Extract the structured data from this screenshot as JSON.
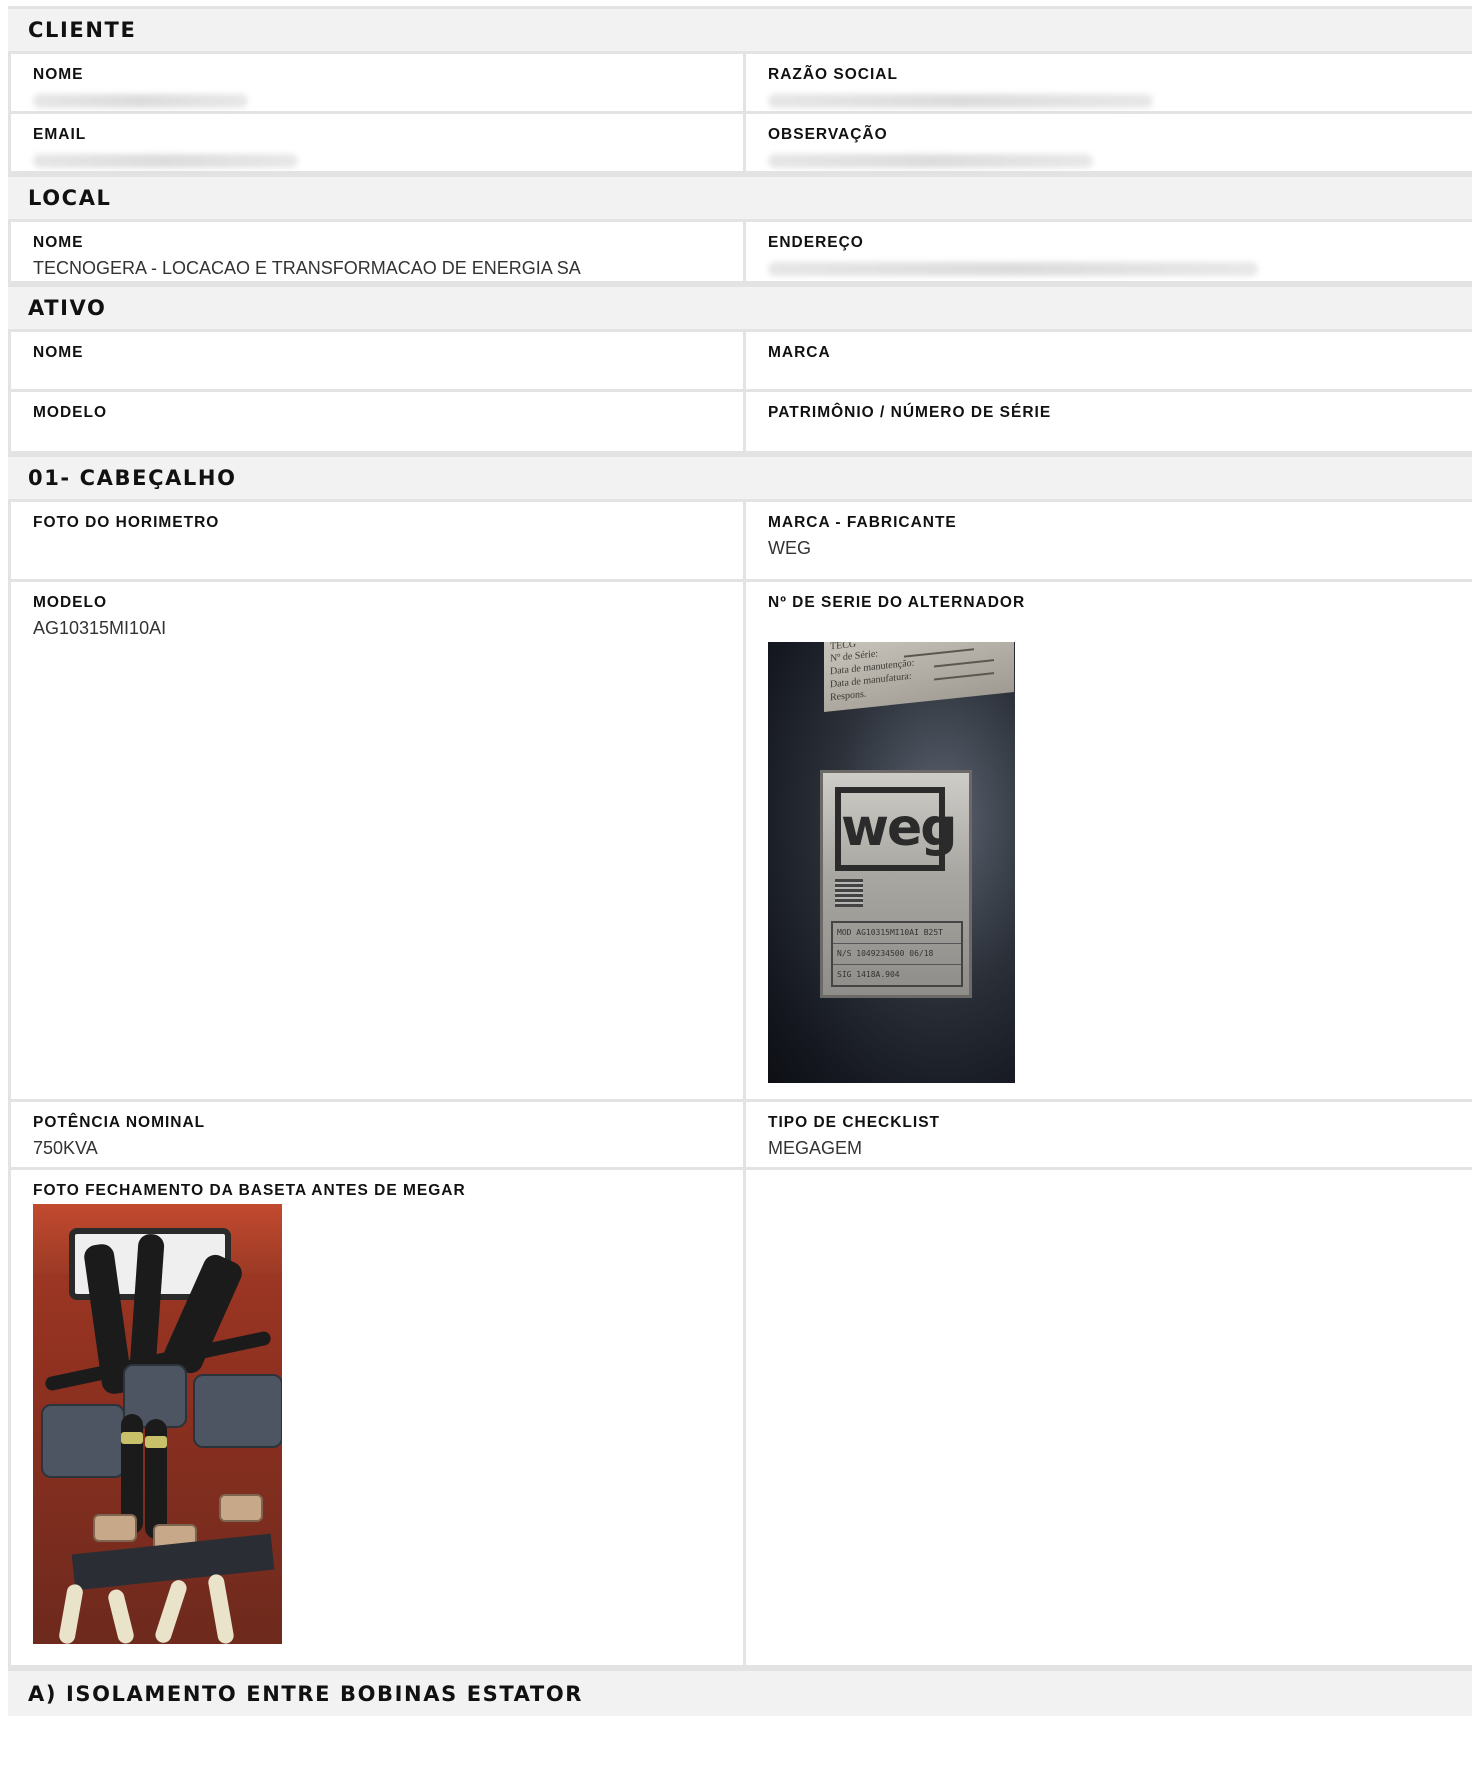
{
  "sections": {
    "cliente": {
      "title": "CLIENTE",
      "nome_label": "NOME",
      "razao_label": "RAZÃO SOCIAL",
      "email_label": "EMAIL",
      "obs_label": "OBSERVAÇÃO"
    },
    "local": {
      "title": "LOCAL",
      "nome_label": "NOME",
      "nome_value": "TECNOGERA - LOCACAO E TRANSFORMACAO DE ENERGIA SA",
      "endereco_label": "ENDEREÇO"
    },
    "ativo": {
      "title": "ATIVO",
      "nome_label": "NOME",
      "marca_label": "MARCA",
      "modelo_label": "MODELO",
      "patrimonio_label": "PATRIMÔNIO / NÚMERO DE SÉRIE"
    },
    "cabecalho": {
      "title": "01- CABEÇALHO",
      "foto_horimetro_label": "FOTO DO HORIMETRO",
      "marca_label": "MARCA - FABRICANTE",
      "marca_value": "WEG",
      "modelo_label": "MODELO",
      "modelo_value": "AG10315MI10AI",
      "serie_label": "Nº DE SERIE DO ALTERNADOR",
      "potencia_label": "POTÊNCIA NOMINAL",
      "potencia_value": "750KVA",
      "tipo_label": "TIPO DE CHECKLIST",
      "tipo_value": "MEGAGEM",
      "foto_baseta_label": "FOTO FECHAMENTO DA BASETA ANTES DE MEGAR"
    },
    "isolamento": {
      "title": "A) ISOLAMENTO ENTRE BOBINAS ESTATOR"
    }
  },
  "photos": {
    "weg_plate": {
      "logo_text": "weg",
      "label_lines": [
        "TECG",
        "Nº de Série:",
        "Data de manutenção:",
        "Data de manufatura:",
        "Respons."
      ],
      "plate_rows": [
        "MOD  AG10315MI10AI B25T",
        "N/S  1049234500 06/18",
        "SIG  1418A.904"
      ]
    }
  }
}
